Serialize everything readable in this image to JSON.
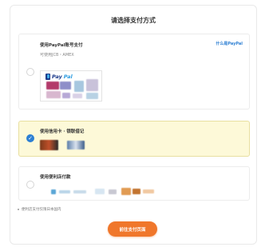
{
  "dialog": {
    "title": "请选择支付方式",
    "submit_label": "前往支付页面",
    "footnote": "便利店支付仅限日本国内"
  },
  "options": {
    "paypal": {
      "label": "使用PayPal账号支付",
      "sub": "可使用JCB・AMEX",
      "link": "什么是PayPal",
      "logo_pay": "Pay",
      "logo_pal": "Pal",
      "checked": false
    },
    "card": {
      "label": "使用信用卡 · 银联借记",
      "checked": true
    },
    "konbini": {
      "label": "使用便利店付款",
      "checked": false
    }
  },
  "colors": {
    "accent": "#f0772b",
    "selected_bg": "#fdf9d8",
    "check": "#2d7fd3",
    "paypal_navy": "#1b3a8a",
    "paypal_blue": "#2b9be0"
  },
  "icons": [
    "check-icon",
    "paypal-logo"
  ]
}
